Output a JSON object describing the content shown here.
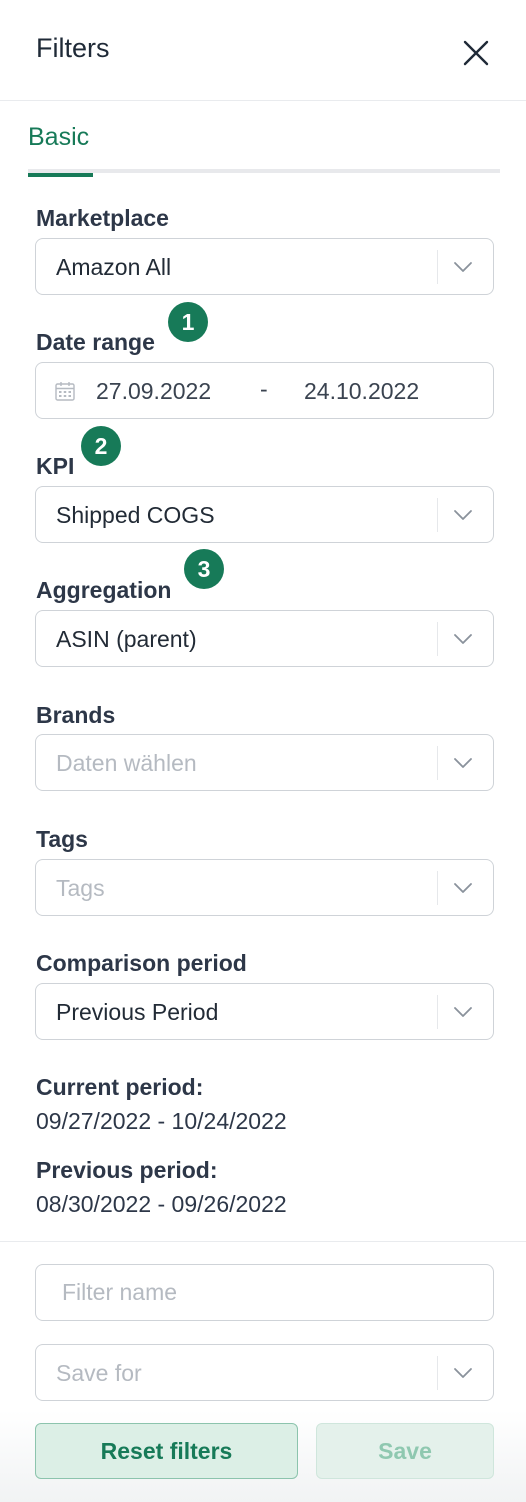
{
  "header": {
    "title": "Filters",
    "close_icon": "close-icon"
  },
  "tabs": [
    {
      "label": "Basic",
      "active": true
    }
  ],
  "marketplace": {
    "label": "Marketplace",
    "value": "Amazon All"
  },
  "date_range": {
    "label": "Date range",
    "start": "27.09.2022",
    "separator": "-",
    "end": "24.10.2022",
    "icon": "calendar-icon"
  },
  "kpi": {
    "label": "KPI",
    "value": "Shipped COGS"
  },
  "aggregation": {
    "label": "Aggregation",
    "value": "ASIN (parent)"
  },
  "brands": {
    "label": "Brands",
    "placeholder": "Daten wählen"
  },
  "tags": {
    "label": "Tags",
    "placeholder": "Tags"
  },
  "comparison": {
    "label": "Comparison period",
    "value": "Previous Period"
  },
  "current_period": {
    "label": "Current period:",
    "value": "09/27/2022 - 10/24/2022"
  },
  "previous_period": {
    "label": "Previous period:",
    "value": "08/30/2022 - 09/26/2022"
  },
  "footer": {
    "filter_name": {
      "placeholder": "Filter name",
      "value": ""
    },
    "save_for": {
      "placeholder": "Save for"
    },
    "reset_label": "Reset filters",
    "save_label": "Save"
  },
  "badges": [
    "1",
    "2",
    "3"
  ],
  "colors": {
    "accent": "#177a58",
    "badge": "#177a58",
    "reset_bg": "#dcefe6",
    "save_bg": "#e4f1eb"
  }
}
